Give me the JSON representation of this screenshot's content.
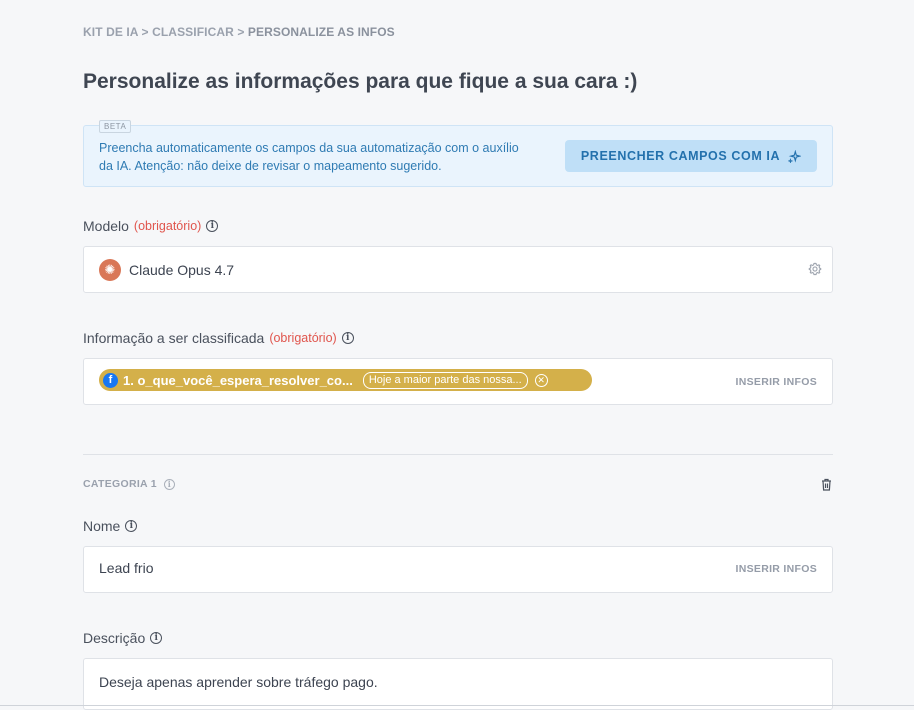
{
  "breadcrumb": {
    "item1": "KIT DE IA",
    "sep1": " > ",
    "item2": "CLASSIFICAR",
    "sep2": " > ",
    "current": "PERSONALIZE AS INFOS"
  },
  "page_title": "Personalize as informações para que fique a sua cara :)",
  "beta_banner": {
    "tag": "BETA",
    "text": "Preencha automaticamente os campos da sua automatização com o auxílio da IA. Atenção: não deixe de revisar o mapeamento sugerido.",
    "button_label": "PREENCHER CAMPOS COM IA",
    "button_icon": "sparkles-icon"
  },
  "model": {
    "label": "Modelo",
    "required": "(obrigatório)",
    "value": "Claude Opus 4.7",
    "logo_icon": "claude-logo-icon",
    "settings_icon": "gear-icon"
  },
  "info_classified": {
    "label": "Informação a ser classificada",
    "required": "(obrigatório)",
    "tag_icon": "facebook-icon",
    "tag_label": "1. o_que_você_espera_resolver_co...",
    "tag_value": "Hoje a maior parte das nossa...",
    "insert_label": "INSERIR INFOS"
  },
  "category": {
    "title": "CATEGORIA 1",
    "name_label": "Nome",
    "name_value": "Lead frio",
    "name_insert_label": "INSERIR INFOS",
    "description_label": "Descrição",
    "description_value": "Deseja apenas aprender sobre tráfego pago."
  },
  "colors": {
    "accent_blue": "#2371ad",
    "required_red": "#e0554d",
    "tag_gold": "#d4b04a"
  }
}
